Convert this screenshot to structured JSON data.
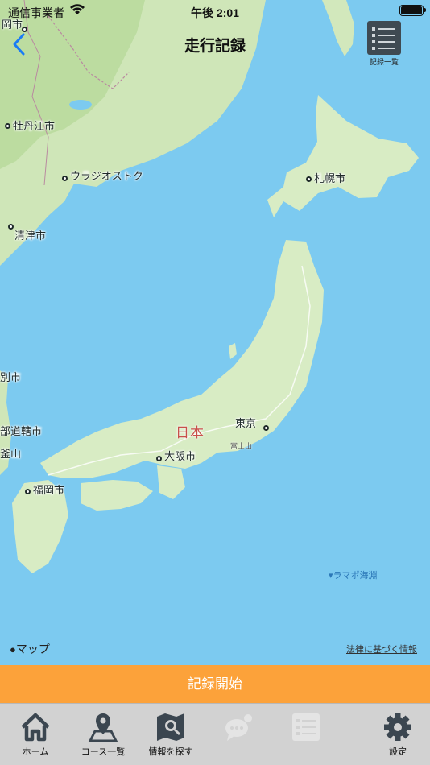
{
  "status": {
    "carrier": "通信事業者",
    "time": "午後 2:01"
  },
  "nav": {
    "title": "走行記録",
    "record_list_label": "記録一覧"
  },
  "map": {
    "cities": {
      "okashi": "岡市",
      "mudanjiang": "牡丹江市",
      "vladivostok": "ウラジオストク",
      "qingjin": "清津市",
      "sapporo": "札幌市",
      "betsushi": "別市",
      "bushan": "部道轄市",
      "busan": "釜山",
      "fukuoka": "福岡市",
      "osaka": "大阪市",
      "tokyo": "東京"
    },
    "country": "日本",
    "mountain": "富士山",
    "sea_feature": "▾ラマポ海淵",
    "maps_logo": "マップ",
    "legal": "法律に基づく情報"
  },
  "start_button": "記録開始",
  "tabs": [
    {
      "label": "ホーム"
    },
    {
      "label": "コース一覧"
    },
    {
      "label": "情報を探す"
    },
    {
      "label": ""
    },
    {
      "label": ""
    },
    {
      "label": "設定"
    }
  ],
  "colors": {
    "accent": "#fca23a",
    "sea": "#7ccaf0",
    "land": "#d8ecc4"
  }
}
